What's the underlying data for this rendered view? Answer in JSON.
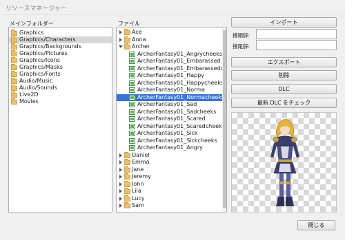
{
  "window": {
    "title": "リソースマネージャー"
  },
  "folders_panel": {
    "label": "メインフォルダー",
    "items": [
      {
        "label": "Graphics",
        "selected": false
      },
      {
        "label": "Graphics/Characters",
        "selected": true
      },
      {
        "label": "Graphics/Backgrounds",
        "selected": false
      },
      {
        "label": "Graphics/Pictures",
        "selected": false
      },
      {
        "label": "Graphics/Icons",
        "selected": false
      },
      {
        "label": "Graphics/Masks",
        "selected": false
      },
      {
        "label": "Graphics/Fonts",
        "selected": false
      },
      {
        "label": "Audio/Music",
        "selected": false
      },
      {
        "label": "Audio/Sounds",
        "selected": false
      },
      {
        "label": "Live2D",
        "selected": false
      },
      {
        "label": "Movies",
        "selected": false
      }
    ]
  },
  "files_panel": {
    "label": "ファイル",
    "items": [
      {
        "label": "Ace",
        "kind": "folder",
        "expanded": false,
        "depth": 0
      },
      {
        "label": "Anna",
        "kind": "folder",
        "expanded": false,
        "depth": 0
      },
      {
        "label": "Archer",
        "kind": "folder",
        "expanded": true,
        "depth": 0
      },
      {
        "label": "ArcherFantasy01_Angrycheeks",
        "kind": "file",
        "depth": 1
      },
      {
        "label": "ArcherFantasy01_Embarassed",
        "kind": "file",
        "depth": 1
      },
      {
        "label": "ArcherFantasy01_Embarassedcheeks",
        "kind": "file",
        "depth": 1
      },
      {
        "label": "ArcherFantasy01_Happy",
        "kind": "file",
        "depth": 1
      },
      {
        "label": "ArcherFantasy01_Happycheeks",
        "kind": "file",
        "depth": 1
      },
      {
        "label": "ArcherFantasy01_Norma",
        "kind": "file",
        "depth": 1
      },
      {
        "label": "ArcherFantasy01_Normacheeks",
        "kind": "file",
        "depth": 1,
        "selected": true
      },
      {
        "label": "ArcherFantasy01_Sad",
        "kind": "file",
        "depth": 1
      },
      {
        "label": "ArcherFantasy01_Sadcheeks",
        "kind": "file",
        "depth": 1
      },
      {
        "label": "ArcherFantasy01_Scared",
        "kind": "file",
        "depth": 1
      },
      {
        "label": "ArcherFantasy01_Scaredcheeks",
        "kind": "file",
        "depth": 1
      },
      {
        "label": "ArcherFantasy01_Sick",
        "kind": "file",
        "depth": 1
      },
      {
        "label": "ArcherFantasy01_Sickcheeks",
        "kind": "file",
        "depth": 1
      },
      {
        "label": "ArcherFantasy01_Angry",
        "kind": "file",
        "depth": 1
      },
      {
        "label": "Daniel",
        "kind": "folder",
        "expanded": false,
        "depth": 0
      },
      {
        "label": "Emma",
        "kind": "folder",
        "expanded": false,
        "depth": 0
      },
      {
        "label": "Jane",
        "kind": "folder",
        "expanded": false,
        "depth": 0
      },
      {
        "label": "Jeremy",
        "kind": "folder",
        "expanded": false,
        "depth": 0
      },
      {
        "label": "John",
        "kind": "folder",
        "expanded": false,
        "depth": 0
      },
      {
        "label": "Lila",
        "kind": "folder",
        "expanded": false,
        "depth": 0
      },
      {
        "label": "Lucy",
        "kind": "folder",
        "expanded": false,
        "depth": 0
      },
      {
        "label": "Sam",
        "kind": "folder",
        "expanded": false,
        "depth": 0
      }
    ]
  },
  "actions": {
    "import_label": "インポート",
    "prefix_label": "接頭辞:",
    "prefix_value": "",
    "suffix_label": "接尾辞:",
    "suffix_value": "",
    "export_label": "エクスポート",
    "delete_label": "削除",
    "dlc_label": "DLC",
    "check_dlc_label": "最新 DLC をチェック",
    "close_label": "閉じる"
  },
  "colors": {
    "selection": "#3875d7",
    "folder": "#e8c16a",
    "image_file": "#5fae5f"
  },
  "icons": {
    "folder": "folder-icon",
    "file": "image-file-icon",
    "collapsed": "chevron-right-icon",
    "expanded": "chevron-down-icon"
  }
}
